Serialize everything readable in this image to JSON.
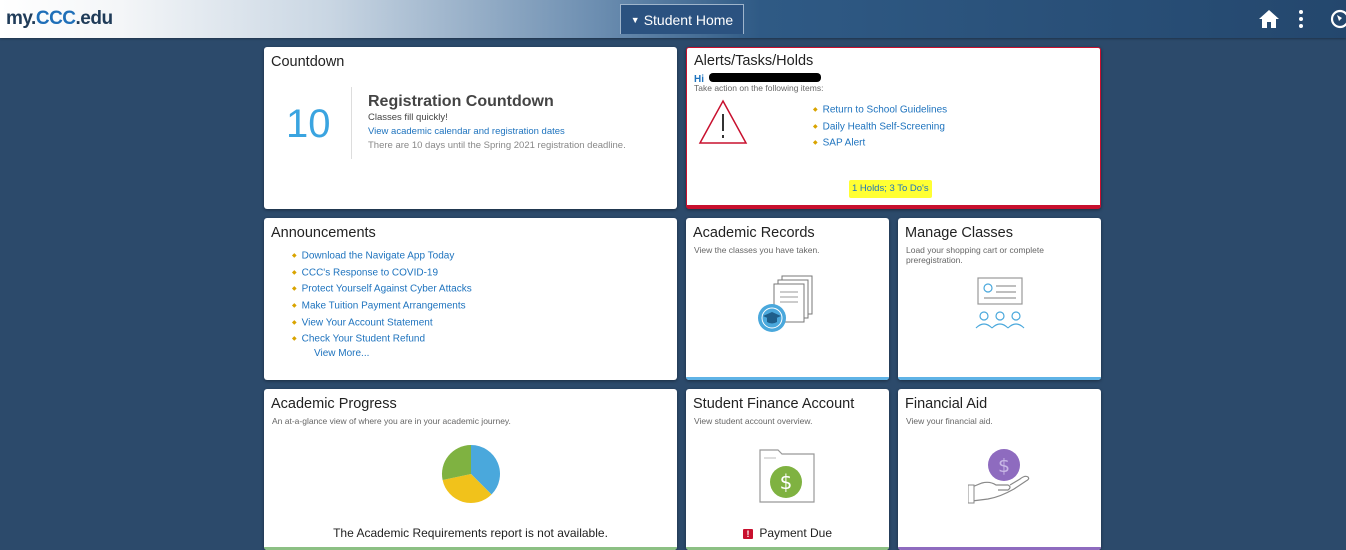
{
  "header": {
    "logo_prefix": "my.",
    "logo_ccc": "CCC",
    "logo_suffix": ".edu",
    "home_tab": "Student Home",
    "home_icon": "home-icon",
    "actions_icon": "more-vertical-icon",
    "nav_icon": "navbar-icon"
  },
  "countdown": {
    "title": "Countdown",
    "number": "10",
    "heading": "Registration Countdown",
    "line1": "Classes fill quickly!",
    "link": "View academic calendar and registration dates",
    "note": "There are 10 days until the Spring 2021 registration deadline."
  },
  "alerts": {
    "title": "Alerts/Tasks/Holds",
    "greeting": "Hi",
    "prompt": "Take action on the following items:",
    "items": [
      "Return to School Guidelines",
      "Daily Health Self-Screening",
      "SAP Alert"
    ],
    "summary": "1 Holds; 3 To Do's",
    "icon": "warning-triangle-icon"
  },
  "announcements": {
    "title": "Announcements",
    "items": [
      "Download the Navigate App Today",
      "CCC's Response to COVID-19",
      "Protect Yourself Against Cyber Attacks",
      "Make Tuition Payment Arrangements",
      "View Your Account Statement",
      "Check Your Student Refund"
    ],
    "more": "View More..."
  },
  "academic_records": {
    "title": "Academic Records",
    "subtitle": "View the classes you have taken.",
    "icon": "transcript-graduation-icon"
  },
  "manage_classes": {
    "title": "Manage Classes",
    "subtitle": "Load your shopping cart or complete preregistration.",
    "icon": "classroom-presentation-icon"
  },
  "academic_progress": {
    "title": "Academic Progress",
    "subtitle": "An at-a-glance view of where you are in your academic journey.",
    "message": "The Academic Requirements report is not available.",
    "icon": "pie-chart-icon"
  },
  "student_finance": {
    "title": "Student Finance Account",
    "subtitle": "View student account overview.",
    "status": "Payment Due",
    "icon": "dollar-folder-icon"
  },
  "financial_aid": {
    "title": "Financial Aid",
    "subtitle": "View your financial aid.",
    "icon": "hand-coin-icon"
  },
  "colors": {
    "background": "#2c4a6b",
    "link": "#1e73be",
    "alert_red": "#c8102e",
    "highlight": "#ffff33",
    "blue_bar": "#5fb3e6",
    "green_bar": "#8cc084",
    "purple_bar": "#8e6bbf"
  }
}
